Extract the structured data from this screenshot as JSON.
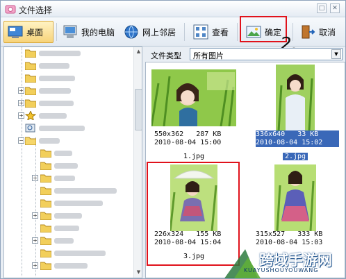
{
  "window": {
    "title": "文件选择",
    "controls": [
      "□",
      "✕"
    ]
  },
  "toolbar": {
    "buttons": [
      {
        "label": "桌面",
        "icon": "desktop-icon",
        "active": true
      },
      {
        "label": "我的电脑",
        "icon": "computer-icon"
      },
      {
        "label": "网上邻居",
        "icon": "network-icon"
      },
      {
        "label": "查看",
        "icon": "view-grid-icon"
      },
      {
        "label": "确定",
        "icon": "ok-image-icon"
      },
      {
        "label": "取消",
        "icon": "cancel-door-icon"
      }
    ]
  },
  "annotation": {
    "step_number": "2."
  },
  "filter": {
    "label": "文件类型",
    "selected": "所有图片"
  },
  "files": [
    {
      "name": "1.jpg",
      "dimensions": "550x362",
      "size": "287 KB",
      "date": "2010-08-04 15:00",
      "selected": false
    },
    {
      "name": "2.jpg",
      "dimensions": "336x640",
      "size": "33 KB",
      "date": "2010-08-04 15:02",
      "selected": true
    },
    {
      "name": "3.jpg",
      "dimensions": "226x324",
      "size": "155 KB",
      "date": "2010-08-04 15:04",
      "selected": false
    },
    {
      "name": "",
      "dimensions": "315x527",
      "size": "333 KB",
      "date": "2010-08-04 15:03",
      "selected": false
    }
  ],
  "watermark": {
    "text": "跨域手游网",
    "sub": "KUAYUSHOUYOUWANG"
  },
  "colors": {
    "highlight": "#3a68b8",
    "annotation_red": "#e0121b",
    "active_button": "#f7d37a"
  }
}
